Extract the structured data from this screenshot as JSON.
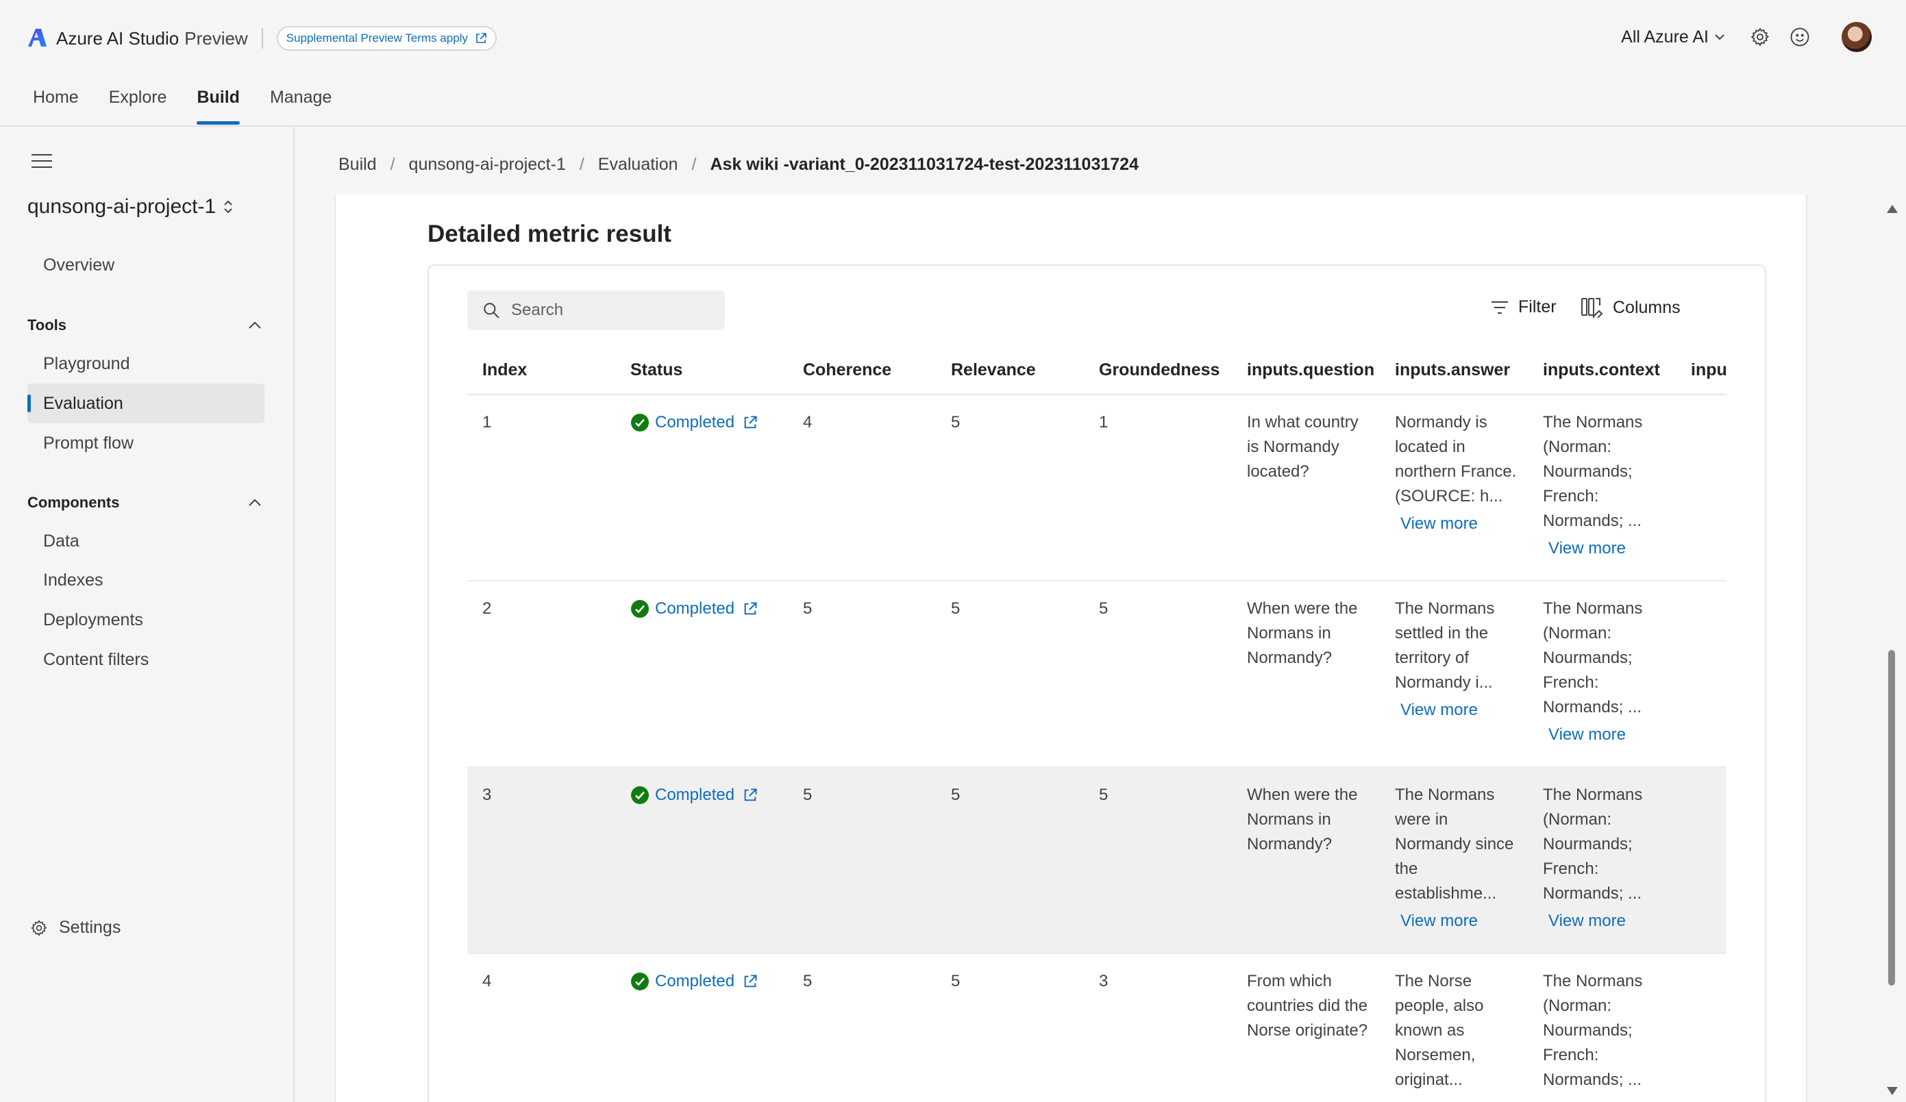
{
  "header": {
    "app_title": "Azure AI Studio",
    "app_badge": "Preview",
    "preview_terms": "Supplemental Preview Terms apply",
    "scope_selector": "All Azure AI",
    "nav": [
      {
        "label": "Home"
      },
      {
        "label": "Explore"
      },
      {
        "label": "Build"
      },
      {
        "label": "Manage"
      }
    ],
    "active_nav": "Build",
    "icons": [
      "settings-icon",
      "feedback-smiley-icon"
    ]
  },
  "sidebar": {
    "project_name": "qunsong-ai-project-1",
    "overview": "Overview",
    "tools_header": "Tools",
    "tools": [
      {
        "label": "Playground"
      },
      {
        "label": "Evaluation"
      },
      {
        "label": "Prompt flow"
      }
    ],
    "active_item": "Evaluation",
    "components_header": "Components",
    "components": [
      {
        "label": "Data"
      },
      {
        "label": "Indexes"
      },
      {
        "label": "Deployments"
      },
      {
        "label": "Content filters"
      }
    ],
    "settings": "Settings"
  },
  "breadcrumb": [
    {
      "label": "Build"
    },
    {
      "label": "qunsong-ai-project-1"
    },
    {
      "label": "Evaluation"
    },
    {
      "label": "Ask wiki -variant_0-202311031724-test-202311031724"
    }
  ],
  "main": {
    "section_title": "Detailed metric result",
    "search_placeholder": "Search",
    "filter_label": "Filter",
    "columns_label": "Columns",
    "view_more_label": "View more",
    "columns": [
      "Index",
      "Status",
      "Coherence",
      "Relevance",
      "Groundedness",
      "inputs.question",
      "inputs.answer",
      "inputs.context",
      "inpu"
    ],
    "rows": [
      {
        "index": "1",
        "status": "Completed",
        "coherence": "4",
        "relevance": "5",
        "groundedness": "1",
        "question": "In what country is Normandy located?",
        "answer": "Normandy is located in northern France. (SOURCE: h...",
        "context": "The Normans (Norman: Nourmands; French: Normands; ..."
      },
      {
        "index": "2",
        "status": "Completed",
        "coherence": "5",
        "relevance": "5",
        "groundedness": "5",
        "question": "When were the Normans in Normandy?",
        "answer": "The Normans settled in the territory of Normandy i...",
        "context": "The Normans (Norman: Nourmands; French: Normands; ..."
      },
      {
        "index": "3",
        "status": "Completed",
        "coherence": "5",
        "relevance": "5",
        "groundedness": "5",
        "question": "When were the Normans in Normandy?",
        "answer": "The Normans were in Normandy since the establishme...",
        "context": "The Normans (Norman: Nourmands; French: Normands; ..."
      },
      {
        "index": "4",
        "status": "Completed",
        "coherence": "5",
        "relevance": "5",
        "groundedness": "3",
        "question": "From which countries did the Norse originate?",
        "answer": "The Norse people, also known as Norsemen, originat...",
        "context": "The Normans (Norman: Nourmands; French: Normands; ..."
      }
    ]
  },
  "colors": {
    "accent": "#0f6cbd",
    "success": "#107c10",
    "background": "#f5f5f5",
    "highlight_row": "#f0f0f0"
  }
}
